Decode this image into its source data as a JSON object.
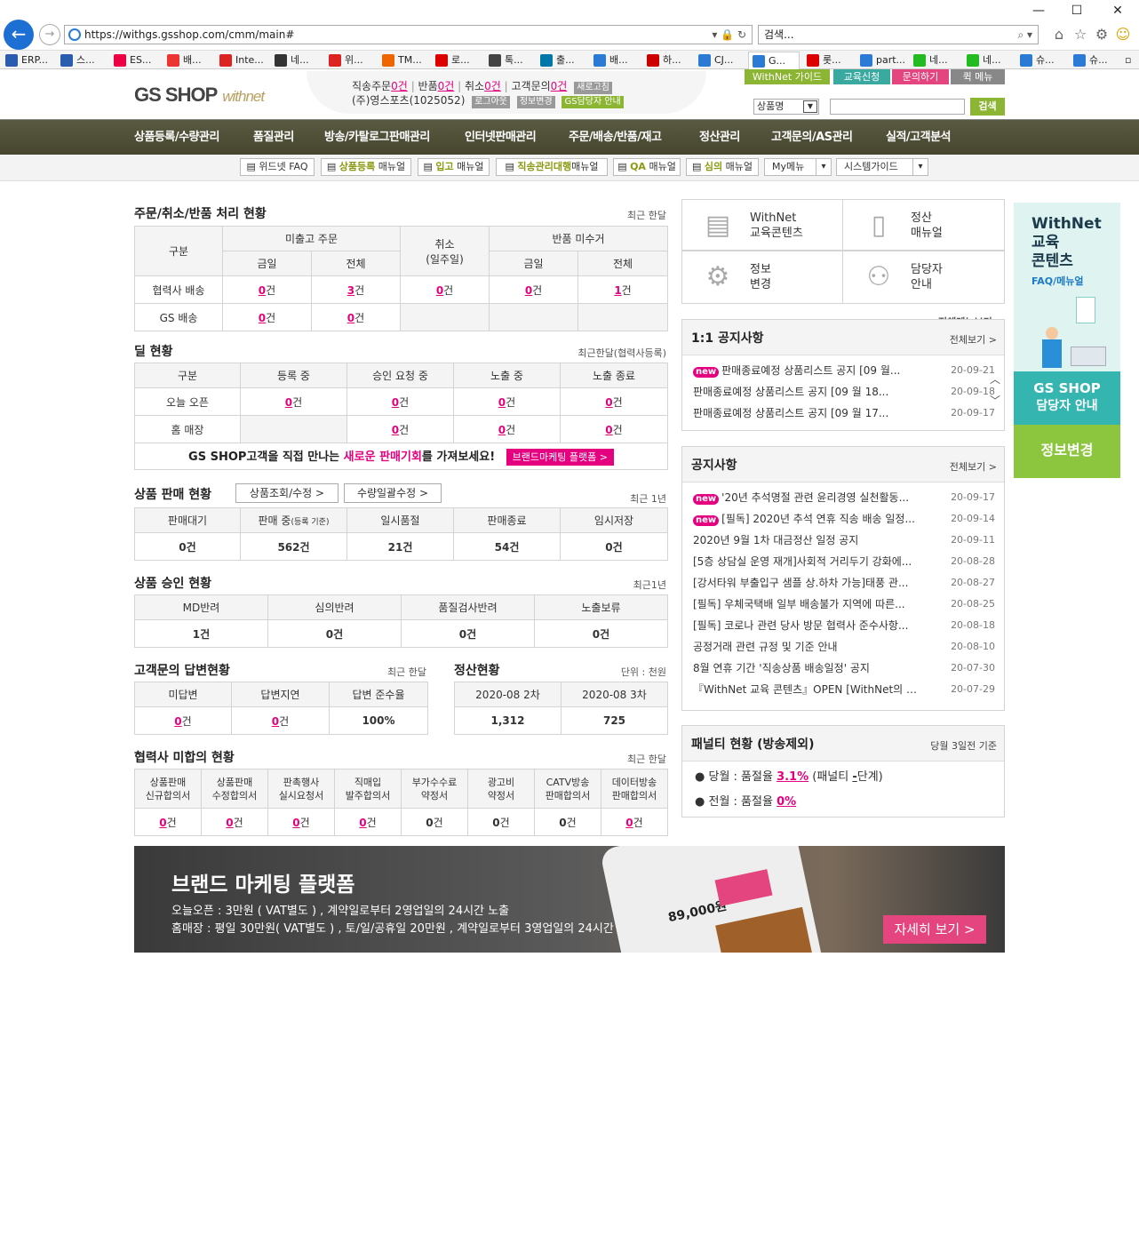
{
  "browser": {
    "url": "https://withgs.gsshop.com/cmm/main#",
    "search_placeholder": "검색...",
    "tabs": [
      {
        "label": "ERP...",
        "color": "#2a5db0"
      },
      {
        "label": "스...",
        "color": "#2a5db0"
      },
      {
        "label": "ES...",
        "color": "#e04"
      },
      {
        "label": "배...",
        "color": "#e33"
      },
      {
        "label": "Inte...",
        "color": "#d22"
      },
      {
        "label": "네...",
        "color": "#333"
      },
      {
        "label": "위...",
        "color": "#d22"
      },
      {
        "label": "TM...",
        "color": "#e60"
      },
      {
        "label": "로...",
        "color": "#d00"
      },
      {
        "label": "톡...",
        "color": "#444"
      },
      {
        "label": "출...",
        "color": "#07a"
      },
      {
        "label": "배...",
        "color": "#2a7ad6"
      },
      {
        "label": "하...",
        "color": "#c00"
      },
      {
        "label": "CJ...",
        "color": "#2a7ad6"
      },
      {
        "label": "G...",
        "color": "#2a7ad6"
      },
      {
        "label": "롯...",
        "color": "#d00"
      },
      {
        "label": "part...",
        "color": "#2a7ad6"
      },
      {
        "label": "네...",
        "color": "#2b2"
      },
      {
        "label": "네...",
        "color": "#2b2"
      },
      {
        "label": "슈...",
        "color": "#2a7ad6"
      },
      {
        "label": "슈...",
        "color": "#2a7ad6"
      }
    ]
  },
  "header": {
    "logo": "GS SHOP",
    "logo_sub": "withnet",
    "stats": {
      "direct_label": "직송주문",
      "direct_val": "0건",
      "return_label": "반품",
      "return_val": "0건",
      "cancel_label": "취소",
      "cancel_val": "0건",
      "inquiry_label": "고객문의",
      "inquiry_val": "0건",
      "refresh": "새로고침"
    },
    "company": "(주)영스포츠(1025052)",
    "logout": "로그아웃",
    "info_change": "정보변경",
    "manager_info": "GS담당자 안내",
    "quick": [
      "WithNet 가이드",
      "교육신청",
      "문의하기",
      "퀵 메뉴"
    ],
    "quick_colors": [
      "#8bb532",
      "#3aa9a0",
      "#e4457f",
      "#888"
    ],
    "search_select": "상품명",
    "search_btn": "검색"
  },
  "gnb": [
    "상품등록/수량관리",
    "품질관리",
    "방송/카탈로그판매관리",
    "인터넷판매관리",
    "주문/배송/반품/재고",
    "정산관리",
    "고객문의/AS관리",
    "실적/고객분석"
  ],
  "subbar": {
    "b1": "위드넷 FAQ",
    "b2a": "상품등록",
    "b2b": " 매뉴얼",
    "b3a": "입고",
    "b3b": " 매뉴얼",
    "b4a": "직송관리대행",
    "b4b": "매뉴얼",
    "b5a": "QA",
    "b5b": " 매뉴얼",
    "b6a": "심의",
    "b6b": " 매뉴얼",
    "mymenu": "My메뉴",
    "sysguide": "시스템가이드",
    "allmenu": "전체메뉴보기 +"
  },
  "orders": {
    "title": "주문/취소/반품 처리 현황",
    "range": "최근 한달",
    "h_type": "구분",
    "h_unshipped": "미출고 주문",
    "h_cancel": "취소",
    "h_cancel_sub": "(일주일)",
    "h_return": "반품 미수거",
    "h_today": "금일",
    "h_all": "전체",
    "rows": [
      {
        "label": "협력사 배송",
        "v": [
          "0",
          "3",
          "0",
          "0",
          "1"
        ]
      },
      {
        "label": "GS 배송",
        "v": [
          "0",
          "0"
        ]
      }
    ],
    "unit": "건"
  },
  "deals": {
    "title": "딜 현황",
    "range": "최근한달(협력사등록)",
    "headers": [
      "구분",
      "등록 중",
      "승인 요청 중",
      "노출 중",
      "노출 종료"
    ],
    "rows": [
      {
        "label": "오늘 오픈",
        "v": [
          "0",
          "0",
          "0",
          "0"
        ]
      },
      {
        "label": "홈 매장",
        "v": [
          "",
          "0",
          "0",
          "0"
        ]
      }
    ],
    "promo_a": "GS SHOP고객을 직접 만나는 ",
    "promo_b": "새로운 판매기회",
    "promo_c": "를 가져보세요!",
    "promo_btn": "브랜드마케팅 플랫폼 >"
  },
  "sales": {
    "title": "상품 판매 현황",
    "btn1": "상품조회/수정 >",
    "btn2": "수량일괄수정 >",
    "range": "최근 1년",
    "headers": [
      "판매대기",
      "판매 중",
      "일시품절",
      "판매종료",
      "임시저장"
    ],
    "h2_sub": "(등록 기준)",
    "values": [
      "0건",
      "562건",
      "21건",
      "54건",
      "0건"
    ]
  },
  "approval": {
    "title": "상품 승인 현황",
    "range": "최근1년",
    "headers": [
      "MD반려",
      "심의반려",
      "품질검사반려",
      "노출보류"
    ],
    "values": [
      "1건",
      "0건",
      "0건",
      "0건"
    ]
  },
  "cs": {
    "title": "고객문의 답변현황",
    "range": "최근 한달",
    "headers": [
      "미답변",
      "답변지연",
      "답변 준수율"
    ],
    "values": [
      "0",
      "0",
      "100%"
    ]
  },
  "settle": {
    "title": "정산현황",
    "unit": "단위 : 천원",
    "headers": [
      "2020-08 2차",
      "2020-08 3차"
    ],
    "values": [
      "1,312",
      "725"
    ]
  },
  "agreements": {
    "title": "협력사 미합의 현황",
    "range": "최근 한달",
    "headers": [
      [
        "상품판매",
        "신규합의서"
      ],
      [
        "상품판매",
        "수정합의서"
      ],
      [
        "판촉행사",
        "실시요청서"
      ],
      [
        "직매입",
        "발주합의서"
      ],
      [
        "부가수수료",
        "약정서"
      ],
      [
        "광고비",
        "약정서"
      ],
      [
        "CATV방송",
        "판매합의서"
      ],
      [
        "데이터방송",
        "판매합의서"
      ]
    ],
    "values": [
      "0",
      "0",
      "0",
      "0",
      "0",
      "0",
      "0",
      "0"
    ],
    "linked": [
      true,
      true,
      true,
      true,
      false,
      false,
      false,
      true
    ]
  },
  "quick_panel": [
    [
      "WithNet",
      "교육콘텐츠"
    ],
    [
      "정산",
      "매뉴얼"
    ],
    [
      "정보",
      "변경"
    ],
    [
      "담당자",
      "안내"
    ]
  ],
  "notice11": {
    "title": "1:1 공지사항",
    "more": "전체보기 >",
    "items": [
      {
        "new": true,
        "t": "판매종료예정 상품리스트 공지 [09 월...",
        "d": "20-09-21"
      },
      {
        "new": false,
        "t": "판매종료예정 상품리스트 공지 [09 월 18...",
        "d": "20-09-18"
      },
      {
        "new": false,
        "t": "판매종료예정 상품리스트 공지 [09 월 17...",
        "d": "20-09-17"
      }
    ]
  },
  "notice": {
    "title": "공지사항",
    "more": "전체보기 >",
    "items": [
      {
        "new": true,
        "t": "'20년 추석명절 관련 윤리경영 실천활동...",
        "d": "20-09-17"
      },
      {
        "new": true,
        "t": "[필독] 2020년 추석 연휴 직송 배송 일정...",
        "d": "20-09-14"
      },
      {
        "new": false,
        "t": "2020년 9월 1차 대금정산 일정 공지",
        "d": "20-09-11"
      },
      {
        "new": false,
        "t": "[5층 상담실 운영 재개]사회적 거리두기 강화에...",
        "d": "20-08-28"
      },
      {
        "new": false,
        "t": "[강서타워 부출입구 샘플 상.하차 가능]태풍 관...",
        "d": "20-08-27"
      },
      {
        "new": false,
        "t": "[필독] 우체국택배 일부 배송불가 지역에 따른...",
        "d": "20-08-25"
      },
      {
        "new": false,
        "t": "[필독] 코로나 관련 당사 방문 협력사 준수사항...",
        "d": "20-08-18"
      },
      {
        "new": false,
        "t": "공정거래 관련 규정 및 기준 안내",
        "d": "20-08-10"
      },
      {
        "new": false,
        "t": "8월 연휴 기간 '직송상품 배송일정' 공지",
        "d": "20-07-30"
      },
      {
        "new": false,
        "t": "『WithNet 교육 콘텐츠』OPEN [WithNet의 모든...",
        "d": "20-07-29"
      }
    ]
  },
  "penalty": {
    "title": "패널티 현황 (방송제외)",
    "basis": "당월 3일전 기준",
    "line1_a": "당월 : 품절율 ",
    "line1_v": "3.1%",
    "line1_b": " (패널티 ",
    "line1_c": "-",
    "line1_d": "단계)",
    "line2_a": "전월 : 품절율 ",
    "line2_v": "0%"
  },
  "side_ad": {
    "t1": "WithNet",
    "t2": "교육",
    "t3": "콘텐츠",
    "t4": "FAQ/메뉴얼",
    "gs1": "GS SHOP",
    "gs2": "담당자 안내",
    "info": "정보변경"
  },
  "banner": {
    "title": "브랜드 마케팅 플랫폼",
    "line1": "오늘오픈 : 3만원 ( VAT별도 ) , 계약일로부터 2영업일의 24시간 노출",
    "line2": "홈매장 : 평일 30만원( VAT별도 ) , 토/일/공휴일 20만원 , 계약일로부터 3영업일의 24시간 노출",
    "btn": "자세히 보기 >",
    "phone_price": "89,000원"
  }
}
